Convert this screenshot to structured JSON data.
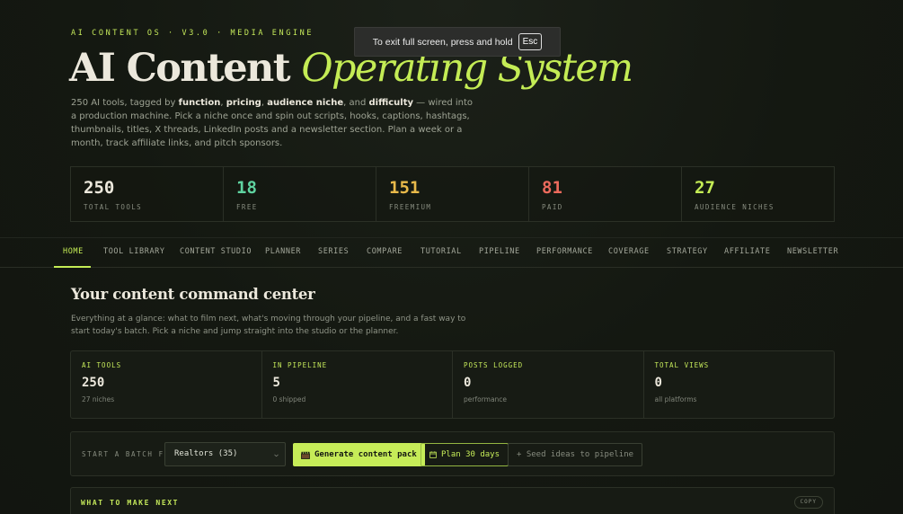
{
  "hero": {
    "eyebrow": "AI CONTENT OS · V3.0 · MEDIA ENGINE",
    "title_main": "AI Content",
    "title_accent": "Operating System",
    "desc": {
      "p1": "250 AI tools, tagged by ",
      "b1": "function",
      "s1": ", ",
      "b2": "pricing",
      "s2": ", ",
      "b3": "audience niche",
      "s3": ", and ",
      "b4": "difficulty",
      "p2": " — wired into a production machine. Pick a niche once and spin out scripts, hooks, captions, hashtags, thumbnails, titles, X threads, LinkedIn posts and a newsletter section. Plan a week or a month, track affiliate links, and pitch sponsors."
    }
  },
  "fullscreen_toast": {
    "text": "To exit full screen, press and hold",
    "key": "Esc"
  },
  "stats": [
    {
      "value": "250",
      "label": "TOTAL TOOLS",
      "color": "#ece8dc"
    },
    {
      "value": "18",
      "label": "FREE",
      "color": "#5fd3a0"
    },
    {
      "value": "151",
      "label": "FREEMIUM",
      "color": "#e8b94a"
    },
    {
      "value": "81",
      "label": "PAID",
      "color": "#ec6a5c"
    },
    {
      "value": "27",
      "label": "AUDIENCE NICHES",
      "color": "#c4ec55"
    }
  ],
  "nav": {
    "tabs": [
      "HOME",
      "TOOL LIBRARY",
      "CONTENT STUDIO",
      "PLANNER",
      "SERIES",
      "COMPARE",
      "TUTORIAL",
      "PIPELINE",
      "PERFORMANCE",
      "COVERAGE",
      "STRATEGY",
      "AFFILIATE",
      "NEWSLETTER"
    ],
    "active": "HOME"
  },
  "home": {
    "title": "Your content command center",
    "desc": "Everything at a glance: what to film next, what's moving through your pipeline, and a fast way to start today's batch. Pick a niche and jump straight into the studio or the planner."
  },
  "metrics": [
    {
      "label": "AI TOOLS",
      "value": "250",
      "sub": "27 niches"
    },
    {
      "label": "IN PIPELINE",
      "value": "5",
      "sub": "0 shipped"
    },
    {
      "label": "POSTS LOGGED",
      "value": "0",
      "sub": "performance"
    },
    {
      "label": "TOTAL VIEWS",
      "value": "0",
      "sub": "all platforms"
    }
  ],
  "batch": {
    "label": "START A BATCH FOR",
    "selected_niche": "Realtors (35)",
    "generate_label": "Generate content pack",
    "plan_label": "Plan 30 days",
    "seed_label": "+ Seed ideas to pipeline",
    "icons": {
      "generate": "clapperboard-icon",
      "plan": "calendar-icon"
    }
  },
  "next": {
    "title": "WHAT TO MAKE NEXT",
    "copy_label": "COPY"
  },
  "colors": {
    "accent": "#c4ec55",
    "background": "#141811",
    "free": "#5fd3a0",
    "freemium": "#e8b94a",
    "paid": "#ec6a5c"
  }
}
